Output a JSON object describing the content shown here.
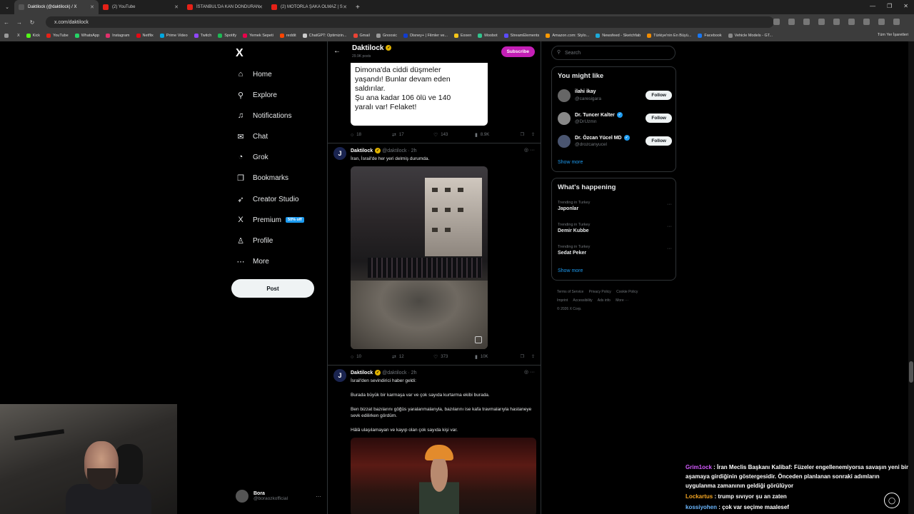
{
  "browser": {
    "tabs": [
      {
        "title": "Daktilock (@daktilock) / X",
        "color": "#555555",
        "active": true
      },
      {
        "title": "(2) YouTube",
        "color": "#e62117",
        "active": false
      },
      {
        "title": "İSTANBUL'DA KAN DONDURAN",
        "color": "#e62117",
        "active": false
      },
      {
        "title": "(2) MOTORLA ŞAKA OLMAZ | S",
        "color": "#e62117",
        "active": false
      }
    ],
    "url": "x.com/daktilock",
    "bookmarks": [
      {
        "label": "Kick",
        "color": "#53fc18"
      },
      {
        "label": "YouTube",
        "color": "#e62117"
      },
      {
        "label": "WhatsApp",
        "color": "#25d366"
      },
      {
        "label": "Instagram",
        "color": "#e1306c"
      },
      {
        "label": "Netflix",
        "color": "#e50914"
      },
      {
        "label": "Prime Video",
        "color": "#00a8e1"
      },
      {
        "label": "Twitch",
        "color": "#9146ff"
      },
      {
        "label": "Spotify",
        "color": "#1db954"
      },
      {
        "label": "Yemek Sepeti",
        "color": "#ea004b"
      },
      {
        "label": "reddit",
        "color": "#ff4500"
      },
      {
        "label": "ChatGPT: Optimizin...",
        "color": "#cccccc"
      },
      {
        "label": "Gmail",
        "color": "#ea4335"
      },
      {
        "label": "Gnoosic",
        "color": "#999999"
      },
      {
        "label": "Disney+ | Filmler ve...",
        "color": "#113ccf"
      },
      {
        "label": "Exxen",
        "color": "#f5c518"
      },
      {
        "label": "Moobot",
        "color": "#31c48d"
      },
      {
        "label": "StreamElements",
        "color": "#5b4bff"
      },
      {
        "label": "Amazon.com: Stylo...",
        "color": "#ff9900"
      },
      {
        "label": "Newsfeed - Sketchfab",
        "color": "#1caad9"
      },
      {
        "label": "Türkiye'nin En Büyü...",
        "color": "#f28c00"
      },
      {
        "label": "Facebook",
        "color": "#1877f2"
      },
      {
        "label": "Vehicle Models - GT...",
        "color": "#888888"
      }
    ],
    "bookmarks_all": "Tüm Yer İşaretleri"
  },
  "nav": {
    "items": [
      {
        "label": "Home",
        "icon": "⌂"
      },
      {
        "label": "Explore",
        "icon": "⚲"
      },
      {
        "label": "Notifications",
        "icon": "♫"
      },
      {
        "label": "Chat",
        "icon": "✉"
      },
      {
        "label": "Grok",
        "icon": "◔"
      },
      {
        "label": "Bookmarks",
        "icon": "❐"
      },
      {
        "label": "Creator Studio",
        "icon": "➶"
      },
      {
        "label": "Premium",
        "icon": "X"
      },
      {
        "label": "Profile",
        "icon": "♙"
      },
      {
        "label": "More",
        "icon": "⋯"
      }
    ],
    "premium_badge": "50% off",
    "post_label": "Post",
    "account": {
      "name": "Bora",
      "handle": "@boraozkofficial"
    }
  },
  "timeline": {
    "header_name": "Daktilock",
    "header_sub": "29.9K posts",
    "subscribe_label": "Subscribe",
    "image_text_lines": [
      "Dimona'da ciddi düşmeler",
      "yaşandı! Bunlar devam eden",
      "saldırılar.",
      "Şu ana kadar 106 ölü ve 140",
      "yaralı var! Felaket!"
    ],
    "actions1": {
      "replies": "18",
      "reposts": "17",
      "likes": "143",
      "views": "8.9K"
    },
    "tweet2": {
      "name": "Daktilock",
      "handle": "@daktilock · 2h",
      "text": "İran, İsrail'de her yeri delmiş durumda.",
      "replies": "10",
      "reposts": "12",
      "likes": "373",
      "views": "10K"
    },
    "tweet3": {
      "name": "Daktilock",
      "handle": "@daktilock · 2h",
      "paragraphs": [
        "İsrail'den sevindirici haber geldi:",
        "Burada büyük bir karmaşa var ve çok sayıda kurtarma ekibi burada.",
        "Ben bizzat bazılarını göğüs yaralanmalarıyla, bazılarını ise kafa travmalarıyla hastaneye sevk edilirken gördüm.",
        "Hâlâ ulaşılamayan ve kayıp olan çok sayıda kişi var."
      ]
    }
  },
  "sidebar": {
    "search_placeholder": "Search",
    "you_might_like_title": "You might like",
    "suggestions": [
      {
        "name": "ilahi ikay",
        "handle": "@caresigara",
        "verified": false
      },
      {
        "name": "Dr. Tuncer Kalter",
        "handle": "@DrUzmn",
        "verified": true
      },
      {
        "name": "Dr. Özcan Yücel MD",
        "handle": "@drozcanyucel",
        "verified": true
      }
    ],
    "follow_label": "Follow",
    "show_more": "Show more",
    "happening_title": "What's happening",
    "trends": [
      {
        "context": "Trending in Turkey",
        "topic": "Japonlar"
      },
      {
        "context": "Trending in Turkey",
        "topic": "Demir Kubbe"
      },
      {
        "context": "Trending in Turkey",
        "topic": "Sedat Peker"
      }
    ],
    "footer_line1": [
      "Terms of Service",
      "Privacy Policy",
      "Cookie Policy"
    ],
    "footer_line2": [
      "Imprint",
      "Accessibility",
      "Ads info",
      "More ···"
    ],
    "footer_copyright": "© 2026 X Corp."
  },
  "chat": {
    "messages": [
      {
        "user": "Grim1ock",
        "text": "İran Meclis Başkanı Kalibaf: Füzeler engellenemiyorsa savaşın yeni bir aşamaya girdiğinin göstergesidir. Önceden planlanan sonraki adımların uygulanma zamanının geldiği görülüyor"
      },
      {
        "user": "Lockartus",
        "text": "trump sıvıyor şu an zaten"
      },
      {
        "user": "kossiyohen",
        "text": "çok var seçime maalesef"
      }
    ]
  }
}
